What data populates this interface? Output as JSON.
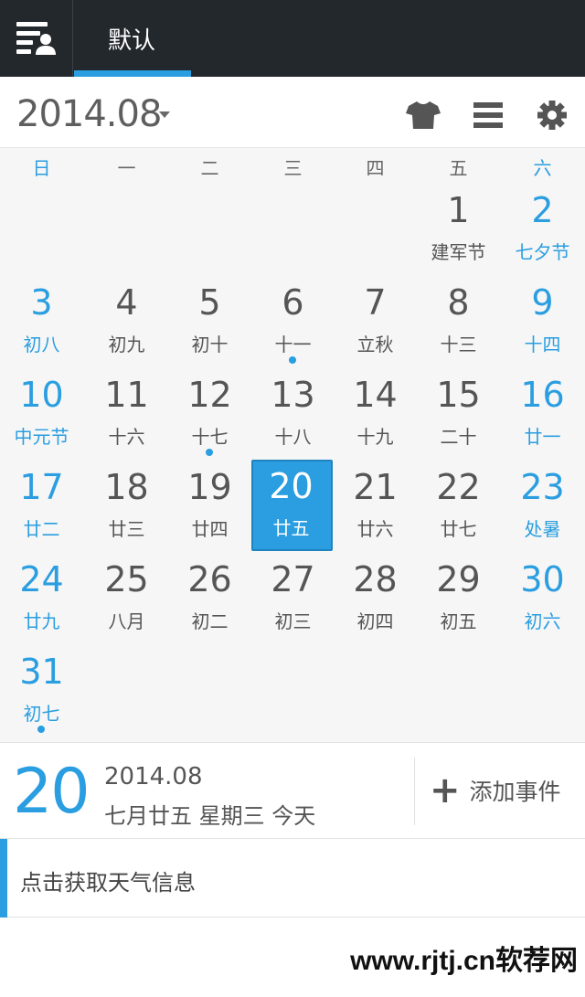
{
  "topbar": {
    "tab_label": "默认",
    "accent_color": "#2a9ee0",
    "icons": [
      "menu-icon"
    ]
  },
  "header": {
    "month": "2014.08",
    "icons": [
      "shirt-icon",
      "list-icon",
      "gear-icon"
    ]
  },
  "calendar": {
    "weekdays": [
      "日",
      "一",
      "二",
      "三",
      "四",
      "五",
      "六"
    ],
    "days": [
      {
        "num": "1",
        "lunar": "建军节"
      },
      {
        "num": "2",
        "lunar": "七夕节"
      },
      {
        "num": "3",
        "lunar": "初八"
      },
      {
        "num": "4",
        "lunar": "初九"
      },
      {
        "num": "5",
        "lunar": "初十"
      },
      {
        "num": "6",
        "lunar": "十一",
        "dot": true
      },
      {
        "num": "7",
        "lunar": "立秋"
      },
      {
        "num": "8",
        "lunar": "十三"
      },
      {
        "num": "9",
        "lunar": "十四"
      },
      {
        "num": "10",
        "lunar": "中元节"
      },
      {
        "num": "11",
        "lunar": "十六"
      },
      {
        "num": "12",
        "lunar": "十七",
        "dot": true
      },
      {
        "num": "13",
        "lunar": "十八"
      },
      {
        "num": "14",
        "lunar": "十九"
      },
      {
        "num": "15",
        "lunar": "二十"
      },
      {
        "num": "16",
        "lunar": "廿一"
      },
      {
        "num": "17",
        "lunar": "廿二"
      },
      {
        "num": "18",
        "lunar": "廿三"
      },
      {
        "num": "19",
        "lunar": "廿四"
      },
      {
        "num": "20",
        "lunar": "廿五",
        "selected": true
      },
      {
        "num": "21",
        "lunar": "廿六"
      },
      {
        "num": "22",
        "lunar": "廿七"
      },
      {
        "num": "23",
        "lunar": "处暑"
      },
      {
        "num": "24",
        "lunar": "廿九"
      },
      {
        "num": "25",
        "lunar": "八月"
      },
      {
        "num": "26",
        "lunar": "初二"
      },
      {
        "num": "27",
        "lunar": "初三"
      },
      {
        "num": "28",
        "lunar": "初四"
      },
      {
        "num": "29",
        "lunar": "初五"
      },
      {
        "num": "30",
        "lunar": "初六"
      },
      {
        "num": "31",
        "lunar": "初七",
        "dot": true
      }
    ]
  },
  "today": {
    "day": "20",
    "year_month": "2014.08",
    "description": "七月廿五 星期三 今天",
    "add_event_label": "添加事件"
  },
  "weather": {
    "label": "点击获取天气信息"
  },
  "watermark": "www.rjtj.cn软荐网"
}
